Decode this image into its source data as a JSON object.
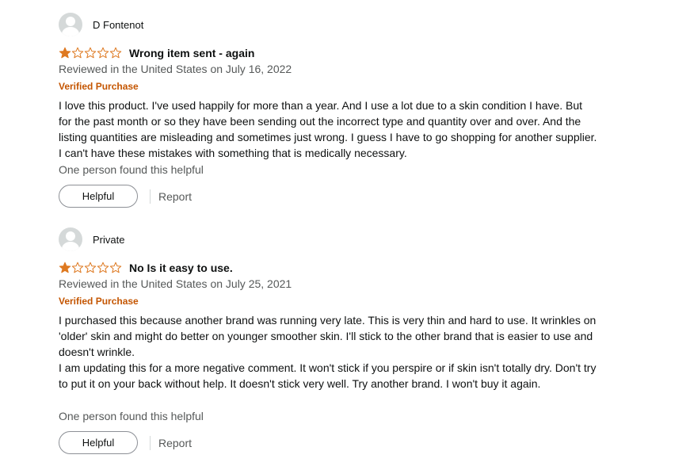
{
  "reviews": [
    {
      "author": "D Fontenot",
      "rating": 1,
      "title": "Wrong item sent - again",
      "date": "Reviewed in the United States on July 16, 2022",
      "badge": "Verified Purchase",
      "body": [
        "I love this product. I've used happily for more than a year. And I use a lot due to a skin condition I have. But for the past month or so they have been sending out the incorrect type and quantity over and over. And the listing quantities are misleading and sometimes just wrong. I guess I have to go shopping for another supplier. I can't have these mistakes with something that is medically necessary."
      ],
      "helpful_text": "One person found this helpful",
      "helpful_button": "Helpful",
      "report_label": "Report"
    },
    {
      "author": "Private",
      "rating": 1,
      "title": "No Is it easy to use.",
      "date": "Reviewed in the United States on July 25, 2021",
      "badge": "Verified Purchase",
      "body": [
        "I purchased this because another brand was running very late. This is very thin and hard to use. It wrinkles on 'older' skin and might do better on younger smoother skin. I'll stick to the other brand that is easier to use and doesn't wrinkle.",
        "I am updating this for a more negative comment. It won't stick if you perspire or if skin isn't totally dry. Don't try to put it on your back without help. It doesn't stick very well. Try another brand. I won't buy it again."
      ],
      "helpful_text": "One person found this helpful",
      "helpful_button": "Helpful",
      "report_label": "Report"
    }
  ],
  "colors": {
    "star_fill": "#de7921",
    "verified": "#c45500",
    "muted": "#565959"
  }
}
